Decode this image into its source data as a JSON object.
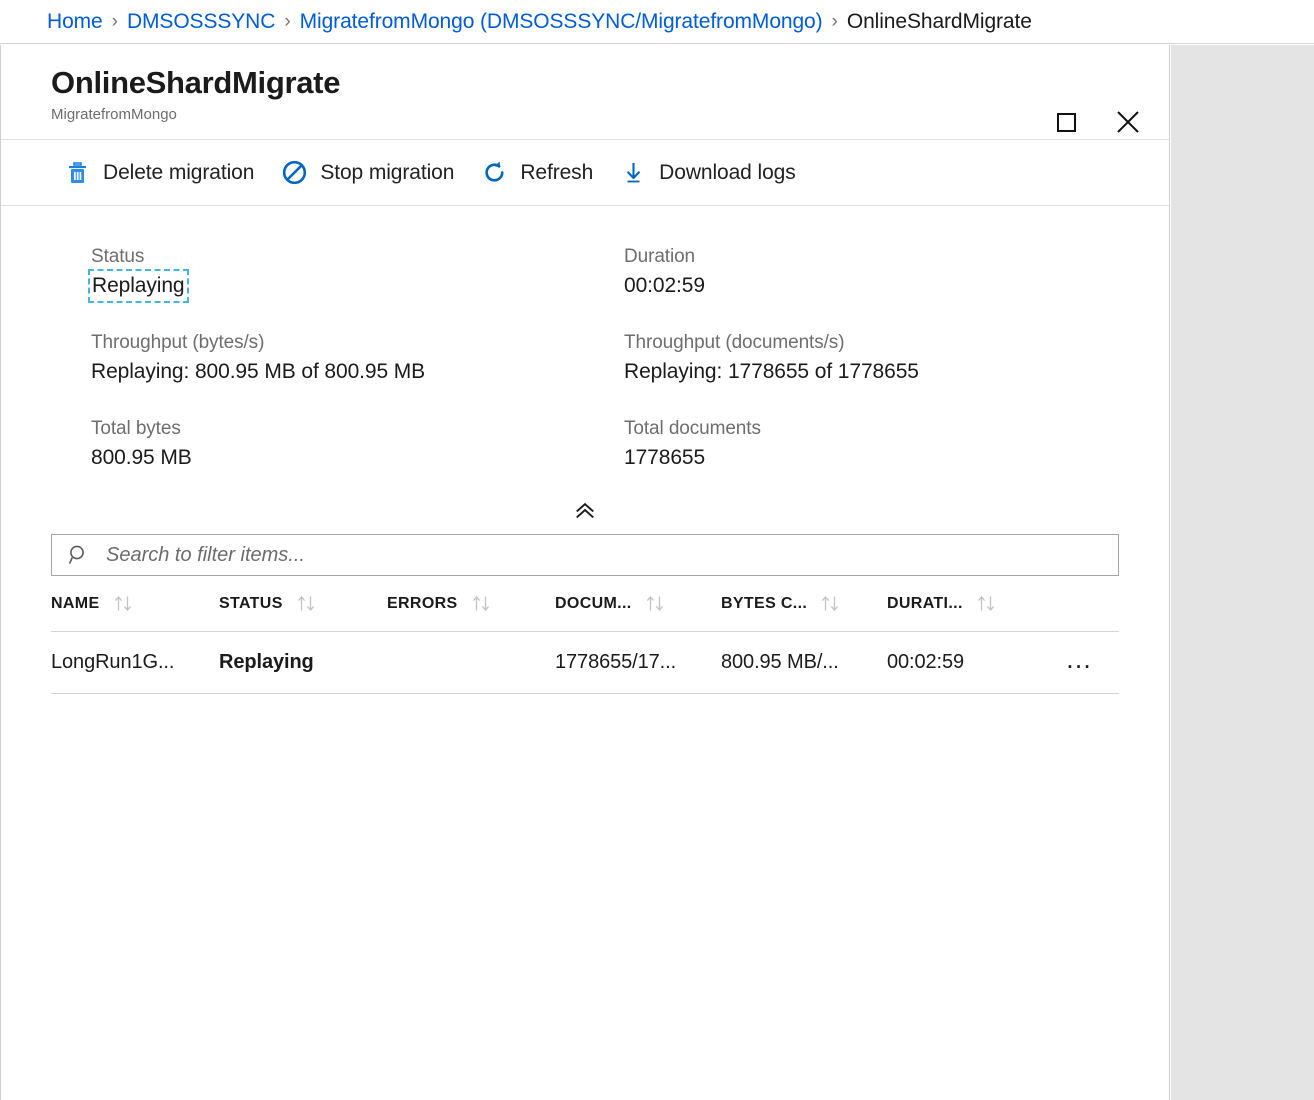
{
  "breadcrumb": {
    "separator": "›",
    "items": [
      {
        "label": "Home",
        "current": false
      },
      {
        "label": "DMSOSSSYNC",
        "current": false
      },
      {
        "label": "MigratefromMongo (DMSOSSSYNC/MigratefromMongo)",
        "current": false
      },
      {
        "label": "OnlineShardMigrate",
        "current": true
      }
    ]
  },
  "blade": {
    "title": "OnlineShardMigrate",
    "subtitle": "MigratefromMongo",
    "window_controls": [
      {
        "name": "maximize-button",
        "icon": "maximize-icon"
      },
      {
        "name": "close-button",
        "icon": "close-icon"
      }
    ]
  },
  "toolbar": {
    "commands": [
      {
        "label": "Delete migration",
        "icon": "trash-icon",
        "color": "#0078d4"
      },
      {
        "label": "Stop migration",
        "icon": "stop-circle-icon",
        "color": "#0067c0"
      },
      {
        "label": "Refresh",
        "icon": "refresh-icon",
        "color": "#0067c0"
      },
      {
        "label": "Download logs",
        "icon": "download-icon",
        "color": "#0067c0"
      }
    ]
  },
  "summary": {
    "fields": [
      {
        "label": "Status",
        "value": "Replaying",
        "focused": true
      },
      {
        "label": "Duration",
        "value": "00:02:59",
        "focused": false
      },
      {
        "label": "Throughput (bytes/s)",
        "value": "Replaying: 800.95 MB of 800.95 MB",
        "focused": false
      },
      {
        "label": "Throughput (documents/s)",
        "value": "Replaying: 1778655 of 1778655",
        "focused": false
      },
      {
        "label": "Total bytes",
        "value": "800.95 MB",
        "focused": false
      },
      {
        "label": "Total documents",
        "value": "1778655",
        "focused": false
      }
    ],
    "collapse_icon": "double-chevron-up-icon"
  },
  "search": {
    "placeholder": "Search to filter items...",
    "value": "",
    "icon": "search-icon"
  },
  "table": {
    "columns": [
      {
        "key": "name",
        "label": "NAME",
        "sortable": true
      },
      {
        "key": "status",
        "label": "STATUS",
        "sortable": true
      },
      {
        "key": "errors",
        "label": "ERRORS",
        "sortable": true
      },
      {
        "key": "documents",
        "label": "DOCUM...",
        "sortable": true
      },
      {
        "key": "bytes",
        "label": "BYTES C...",
        "sortable": true
      },
      {
        "key": "duration",
        "label": "DURATI...",
        "sortable": true
      }
    ],
    "rows": [
      {
        "name": "LongRun1G...",
        "status": "Replaying",
        "errors": "",
        "documents": "1778655/17...",
        "bytes": "800.95 MB/...",
        "duration": "00:02:59",
        "menu": "…"
      }
    ]
  },
  "colors": {
    "link": "#015cda",
    "accent": "#0067c0",
    "focus_outline": "#46b5e0",
    "gutter": "#e4e4e4"
  }
}
